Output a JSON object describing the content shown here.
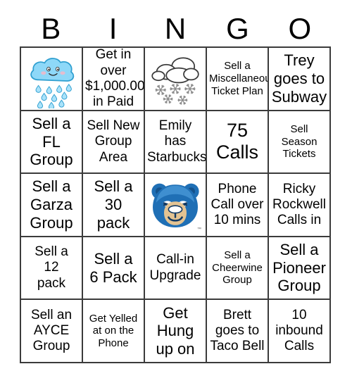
{
  "header": {
    "letters": [
      "B",
      "I",
      "N",
      "G",
      "O"
    ]
  },
  "colors": {
    "grid_line": "#3b3b3b",
    "rain_cloud_fill": "#8ed8f8",
    "rain_cloud_stroke": "#2f9fd0",
    "raindrop_fill": "#a9e2fa",
    "cheek_fill": "#f4b9c8",
    "snow_cloud_stroke": "#3a3a3a",
    "snowflake_fill": "#8a8a8a",
    "mascot_blue": "#1f6fb5",
    "mascot_blue_dark": "#14528c",
    "mascot_blue_light": "#3f8fd0",
    "mascot_tan": "#e3c392",
    "mascot_navy": "#123a63",
    "page_background": "#ffffff"
  },
  "grid": {
    "rows": [
      [
        {
          "type": "image",
          "icon": "rain-cloud-icon",
          "label": "Smiling blue rain cloud with raindrops",
          "text": "",
          "size": "md"
        },
        {
          "type": "text",
          "text": "Get in\nover\n$1,000.00\nin Paid",
          "size": "md"
        },
        {
          "type": "image",
          "icon": "snow-cloud-icon",
          "label": "White cloud with falling snowflakes",
          "text": "",
          "size": "md"
        },
        {
          "type": "text",
          "text": "Sell a\nMiscellaneous\nTicket Plan",
          "size": "sm"
        },
        {
          "type": "text",
          "text": "Trey\ngoes to\nSubway",
          "size": "lg"
        }
      ],
      [
        {
          "type": "text",
          "text": "Sell a\nFL\nGroup",
          "size": "lg"
        },
        {
          "type": "text",
          "text": "Sell New\nGroup\nArea",
          "size": "md"
        },
        {
          "type": "text",
          "text": "Emily has\nStarbucks",
          "size": "md"
        },
        {
          "type": "text",
          "text": "75\nCalls",
          "size": "xl"
        },
        {
          "type": "text",
          "text": "Sell\nSeason\nTickets",
          "size": "sm"
        }
      ],
      [
        {
          "type": "text",
          "text": "Sell a\nGarza\nGroup",
          "size": "lg"
        },
        {
          "type": "text",
          "text": "Sell a\n30\npack",
          "size": "lg"
        },
        {
          "type": "image",
          "icon": "bear-mascot-icon",
          "label": "Blue bear head mascot logo",
          "text": "",
          "size": "md",
          "trademark": "™"
        },
        {
          "type": "text",
          "text": "Phone\nCall over\n10 mins",
          "size": "md"
        },
        {
          "type": "text",
          "text": "Ricky\nRockwell\nCalls in",
          "size": "md"
        }
      ],
      [
        {
          "type": "text",
          "text": "Sell a\n12\npack",
          "size": "md"
        },
        {
          "type": "text",
          "text": "Sell a\n6 Pack",
          "size": "lg"
        },
        {
          "type": "text",
          "text": "Call-in\nUpgrade",
          "size": "md"
        },
        {
          "type": "text",
          "text": "Sell a\nCheerwine\nGroup",
          "size": "sm"
        },
        {
          "type": "text",
          "text": "Sell a\nPioneer\nGroup",
          "size": "lg"
        }
      ],
      [
        {
          "type": "text",
          "text": "Sell an\nAYCE\nGroup",
          "size": "md"
        },
        {
          "type": "text",
          "text": "Get Yelled\nat on the\nPhone",
          "size": "sm"
        },
        {
          "type": "text",
          "text": "Get\nHung\nup on",
          "size": "lg"
        },
        {
          "type": "text",
          "text": "Brett\ngoes to\nTaco Bell",
          "size": "md"
        },
        {
          "type": "text",
          "text": "10\ninbound\nCalls",
          "size": "md"
        }
      ]
    ]
  }
}
